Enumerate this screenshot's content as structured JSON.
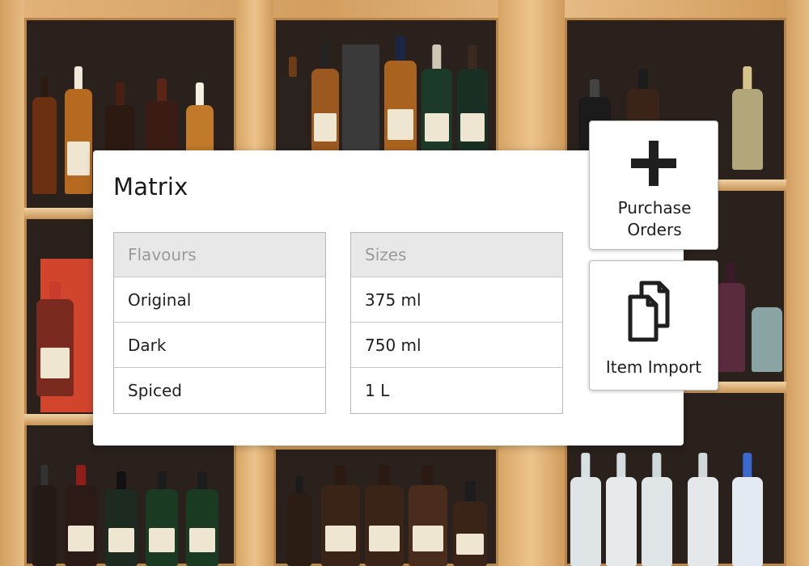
{
  "matrix": {
    "title": "Matrix",
    "flavours": {
      "header": "Flavours",
      "rows": [
        "Original",
        "Dark",
        "Spiced"
      ]
    },
    "sizes": {
      "header": "Sizes",
      "rows": [
        "375 ml",
        "750 ml",
        "1 L"
      ]
    }
  },
  "actions": {
    "purchase_orders": {
      "label": "Purchase Orders",
      "icon": "plus-icon"
    },
    "item_import": {
      "label": "Item Import",
      "icon": "documents-icon"
    }
  },
  "background": {
    "description_icon": "liquor-cabinet-photo"
  }
}
